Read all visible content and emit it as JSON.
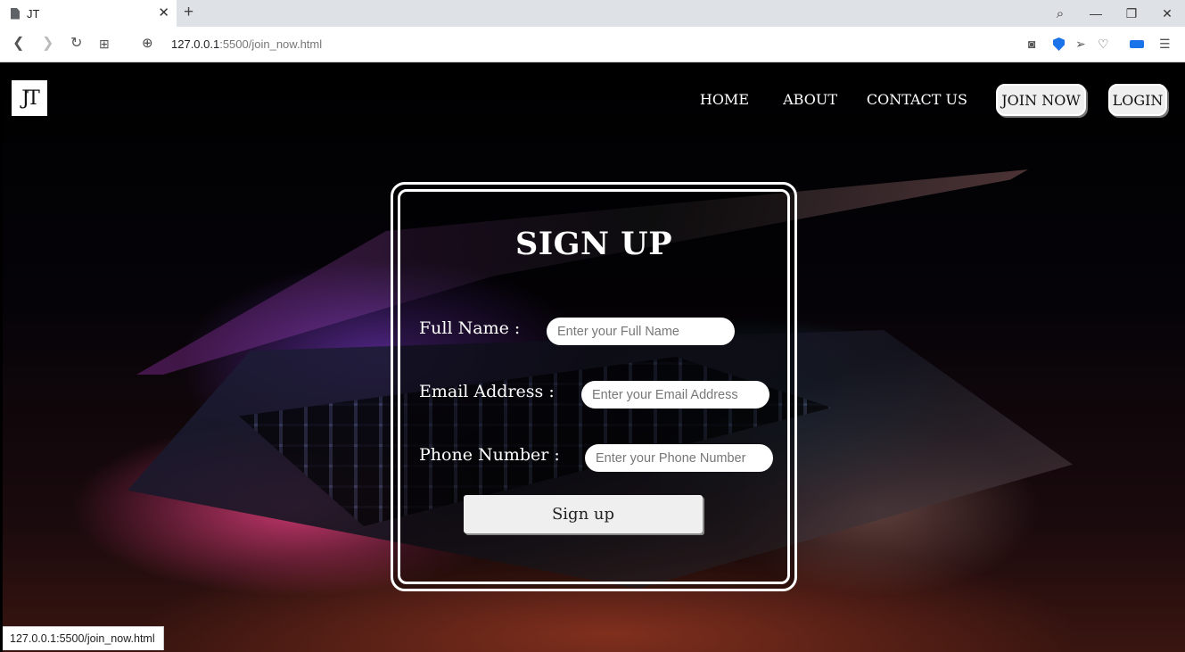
{
  "browser": {
    "tab_title": "JT",
    "new_tab": "+",
    "url_host": "127.0.0.1",
    "url_rest": ":5500/join_now.html",
    "status_url": "127.0.0.1:5500/join_now.html",
    "icons": [
      "back-icon",
      "forward-icon",
      "reload-icon",
      "speed-dial-icon",
      "globe-icon",
      "camera-icon",
      "shield-icon",
      "send-icon",
      "heart-icon",
      "battery-icon",
      "settings-icon",
      "search-icon",
      "minimize-icon",
      "restore-icon",
      "close-icon"
    ]
  },
  "site": {
    "logo_text": "JT",
    "nav": {
      "home": "HOME",
      "about": "ABOUT",
      "contact": "CONTACT US",
      "join": "JOIN NOW",
      "login": "LOGIN"
    }
  },
  "form": {
    "title": "SIGN UP",
    "full_name_label": "Full Name :",
    "full_name_placeholder": "Enter your Full Name",
    "email_label": "Email Address :",
    "email_placeholder": "Enter your Email Address",
    "phone_label": "Phone Number :",
    "phone_placeholder": "Enter your Phone Number",
    "submit_label": "Sign up"
  }
}
